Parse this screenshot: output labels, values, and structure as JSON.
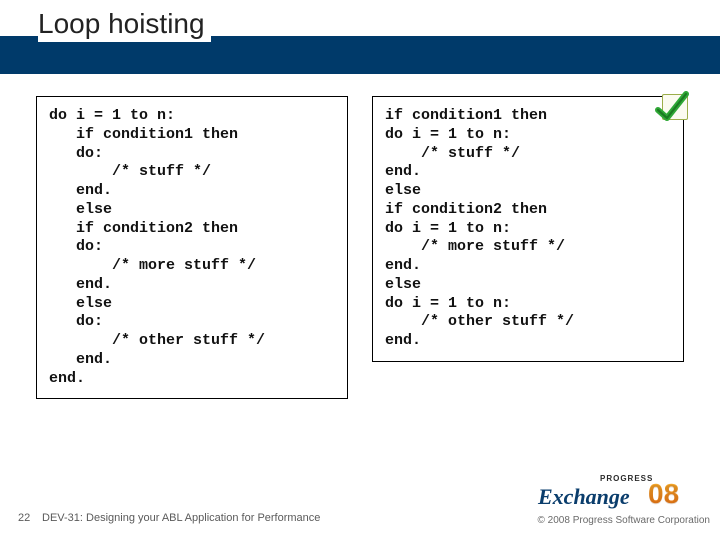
{
  "slide": {
    "title": "Loop hoisting",
    "page_number": "22",
    "footer_title": "DEV-31: Designing your ABL Application for Performance",
    "copyright": "© 2008 Progress Software Corporation",
    "logo": {
      "progress": "PROGRESS",
      "exchange": "Exchange",
      "year": "08"
    }
  },
  "code": {
    "left": "do i = 1 to n:\n   if condition1 then\n   do:\n       /* stuff */\n   end.\n   else\n   if condition2 then\n   do:\n       /* more stuff */\n   end.\n   else\n   do:\n       /* other stuff */\n   end.\nend.",
    "right": "if condition1 then\ndo i = 1 to n:\n    /* stuff */\nend.\nelse\nif condition2 then\ndo i = 1 to n:\n    /* more stuff */\nend.\nelse\ndo i = 1 to n:\n    /* other stuff */\nend."
  },
  "checkmark": {
    "name": "checkmark-icon"
  }
}
